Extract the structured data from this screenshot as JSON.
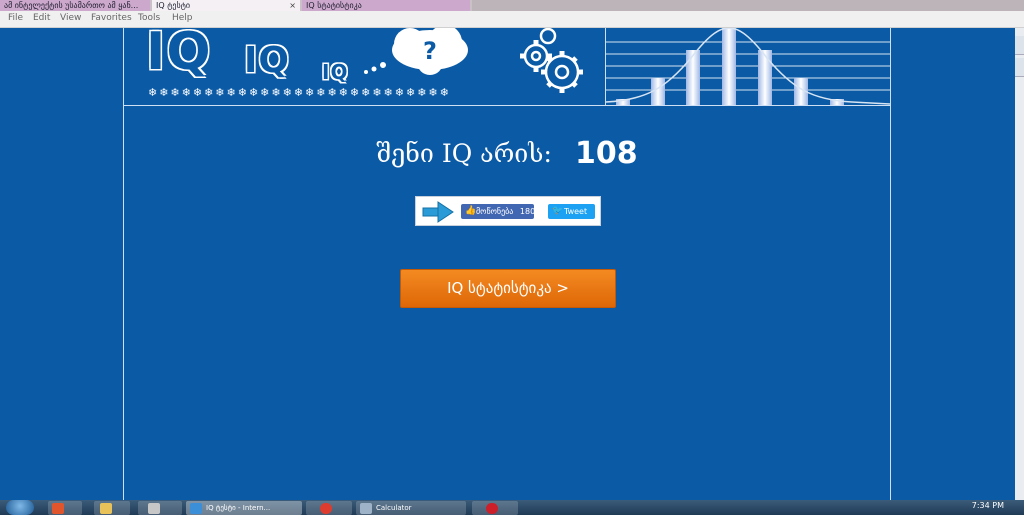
{
  "browser": {
    "tabs": [
      {
        "label": "ამ ინტელექტის უსამართო ამ ყან...",
        "close": ""
      },
      {
        "label": "IQ ტესტი",
        "close": "×"
      },
      {
        "label": "IQ სტატისტიკა",
        "close": ""
      }
    ],
    "menu": [
      "File",
      "Edit",
      "View",
      "Favorites",
      "Tools",
      "Help"
    ]
  },
  "banner": {
    "logo_large": "IQ",
    "logo_medium": "IQ",
    "logo_small": "IQ",
    "cloud_symbol": "?",
    "stars": "❄❄❄❄❄❄❄❄❄❄❄❄❄❄❄❄❄❄❄❄❄❄❄❄❄❄❄",
    "icons": [
      "thought-cloud-icon",
      "gears-icon",
      "bell-curve-chart-icon"
    ]
  },
  "result": {
    "label": "შენი IQ არის:",
    "score": "108"
  },
  "share": {
    "like_label": "მოწონება",
    "like_count": "180",
    "tweet_label": "Tweet"
  },
  "stats_button": {
    "label": "IQ სტატისტიკა >"
  },
  "taskbar": {
    "items": [
      {
        "label": ""
      },
      {
        "label": ""
      },
      {
        "label": ""
      },
      {
        "label": ""
      },
      {
        "label": "IQ ტესტი - Intern..."
      },
      {
        "label": ""
      },
      {
        "label": "Calculator"
      },
      {
        "label": ""
      }
    ],
    "clock": "7:34 PM"
  },
  "colors": {
    "page_background": "#0a5aa6",
    "button_orange": "#e8720c",
    "like_blue": "#4267b2",
    "tweet_blue": "#1da1f2"
  }
}
